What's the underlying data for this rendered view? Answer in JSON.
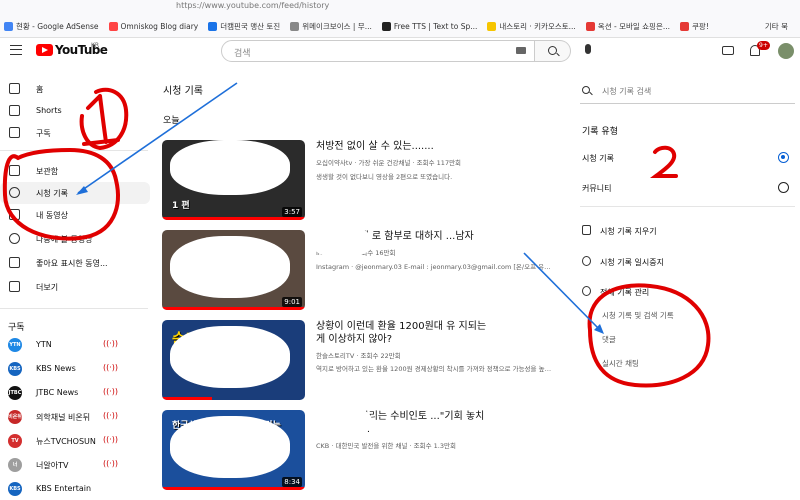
{
  "browser": {
    "url": "https://www.youtube.com/feed/history",
    "bookmarks": [
      {
        "label": "현황 - Google AdSense",
        "color": "#4285f4"
      },
      {
        "label": "Omniskog Blog diary",
        "color": "#ff4444"
      },
      {
        "label": "더캠핀국 맹산 토진",
        "color": "#1a73e8"
      },
      {
        "label": "위메이크보이스 | 무...",
        "color": "#888888"
      },
      {
        "label": "Free TTS | Text to Sp...",
        "color": "#222222"
      },
      {
        "label": "내스토리 · 키카오스토...",
        "color": "#f6c500"
      },
      {
        "label": "옥션 - 모바일 쇼핑은...",
        "color": "#e53935"
      },
      {
        "label": "쿠팡!",
        "color": "#e53935"
      }
    ],
    "other_bookmarks": "기타 북"
  },
  "header": {
    "logo_text": "YouTube",
    "country_code": "KR",
    "search_placeholder": "검색",
    "notification_count": "9+"
  },
  "sidebar": {
    "items": [
      {
        "label": "홈",
        "icon": "home-icon"
      },
      {
        "label": "Shorts",
        "icon": "shorts-icon"
      },
      {
        "label": "구독",
        "icon": "subscriptions-icon"
      },
      {
        "label": "보관함",
        "icon": "library-icon"
      },
      {
        "label": "시청 기록",
        "icon": "history-icon"
      },
      {
        "label": "내 동영상",
        "icon": "my-videos-icon"
      },
      {
        "label": "나중에 볼 동영상",
        "icon": "watch-later-icon"
      },
      {
        "label": "좋아요 표시한 동영...",
        "icon": "liked-icon"
      },
      {
        "label": "더보기",
        "icon": "chevron-down-icon"
      }
    ],
    "subscriptions_heading": "구독",
    "channels": [
      {
        "name": "YTN",
        "avatar_text": "YTN",
        "color": "#1e88e5"
      },
      {
        "name": "KBS News",
        "avatar_text": "KBS",
        "color": "#1565c0"
      },
      {
        "name": "JTBC News",
        "avatar_text": "JTBC",
        "color": "#111111"
      },
      {
        "name": "의학채널 비온뒤",
        "avatar_text": "비온뒤",
        "color": "#c62828"
      },
      {
        "name": "뉴스TVCHOSUN",
        "avatar_text": "TV",
        "color": "#d32f2f"
      },
      {
        "name": "너알아TV",
        "avatar_text": "너",
        "color": "#9e9e9e"
      },
      {
        "name": "KBS Entertain",
        "avatar_text": "KBS",
        "color": "#1565c0"
      }
    ]
  },
  "main": {
    "page_title": "시청 기록",
    "day_heading": "오늘",
    "videos": [
      {
        "title": "처방전 없이 살 수 있는.......",
        "meta": "오십이약사tv · 가장 쉬운 건강채널 · 조회수 117만회",
        "desc": "생생할 것이 없다보니 영상을 2편으로 또였습니다.",
        "duration": "3:57",
        "thumb_text": "1 편",
        "thumb_color": "#2b2b2b",
        "progress": 1.0
      },
      {
        "title": "...들이 질.대.로 함부로 대하지 ...남자",
        "meta": "Instagram · 조회수 16만회",
        "desc": "Instagram · @jeonmary.03 E-mail : jeonmary.03@gmail.com [온/오프 유료상담문의 만만하는 필더 NO! 여자들이 질대로 함부로 대하지",
        "duration": "9:01",
        "thumb_text": "",
        "thumb_color": "#5a4a40",
        "progress": 1.0
      },
      {
        "title": "상황이 이런데 환율 1200원대 유 지되는게 이상하지 않아?",
        "meta": "한슬스토리TV · 조회수 22만회",
        "desc": "역지로 방어하고 있는 환율 1200원 경제상황의 착시를 가져와 정책으로 가능성을 높였다.",
        "duration": "",
        "thumb_text": "숨겨진",
        "thumb_color": "#1a3d7a",
        "progress": 0.35
      },
      {
        "title": "...에 몸니 부리는 수비인토 ...\"기회 놓치지 않겠다\"...",
        "meta": "CKB · 대한민국 발전을 위한 채널 · 조회수 1.3만회",
        "desc": "",
        "duration": "8:34",
        "thumb_text": "한국산에 노골적 몸니 부리는",
        "thumb_color": "#1b4f9c",
        "progress": 1.0
      }
    ]
  },
  "right_panel": {
    "search_placeholder": "시청 기록 검색",
    "history_type_heading": "기록 유형",
    "types": [
      {
        "label": "시청 기록",
        "selected": true
      },
      {
        "label": "커뮤니티",
        "selected": false
      }
    ],
    "actions": [
      {
        "label": "시청 기록 지우기",
        "icon": "trash-icon"
      },
      {
        "label": "시청 기록 일시중지",
        "icon": "pause-icon"
      },
      {
        "label": "전체 기록 관리",
        "icon": "gear-icon"
      }
    ],
    "manage_sub": [
      {
        "label": "시청 기록 및 검색 기록"
      },
      {
        "label": "댓글"
      },
      {
        "label": "실시간 채팅"
      }
    ]
  },
  "annotations": {
    "label_1": "1",
    "label_2": "2",
    "color": "#e00000",
    "arrow_color": "#1e6fd9"
  }
}
